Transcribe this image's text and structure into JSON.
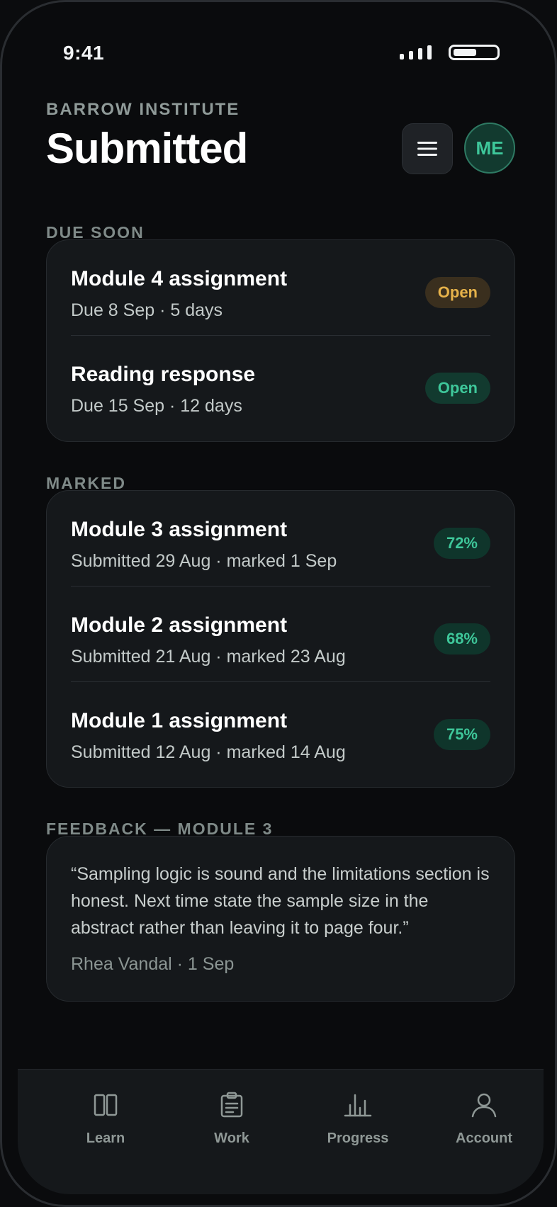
{
  "status": {
    "time": "9:41"
  },
  "header": {
    "institution": "BARROW INSTITUTE",
    "title": "Submitted",
    "avatar_initials": "ME"
  },
  "due_soon": {
    "label": "DUE SOON",
    "items": [
      {
        "title": "Module 4 assignment",
        "sub": "Due 8 Sep · 5 days",
        "badge": "Open",
        "badge_color": "#e6b24a"
      },
      {
        "title": "Reading response",
        "sub": "Due 15 Sep · 12 days",
        "badge": "Open",
        "badge_color": "#3ec79a"
      }
    ]
  },
  "marked": {
    "label": "MARKED",
    "items": [
      {
        "title": "Module 3 assignment",
        "sub": "Submitted 29 Aug · marked 1 Sep",
        "score": "72%"
      },
      {
        "title": "Module 2 assignment",
        "sub": "Submitted 21 Aug · marked 23 Aug",
        "score": "68%"
      },
      {
        "title": "Module 1 assignment",
        "sub": "Submitted 12 Aug · marked 14 Aug",
        "score": "75%"
      }
    ]
  },
  "feedback": {
    "label": "FEEDBACK — MODULE 3",
    "quote": "“Sampling logic is sound and the limitations section is honest. Next time state the sample size in the abstract rather than leaving it to page four.”",
    "meta": "Rhea Vandal · 1 Sep"
  },
  "tabbar": {
    "items": [
      {
        "label": "Learn",
        "icon": "book-icon"
      },
      {
        "label": "Work",
        "icon": "clipboard-icon"
      },
      {
        "label": "Progress",
        "icon": "bar-chart-icon"
      },
      {
        "label": "Account",
        "icon": "user-icon"
      }
    ]
  },
  "colors": {
    "accent": "#3ec79a",
    "warning": "#e6b24a",
    "background": "#0a0b0d",
    "card": "#15181b"
  }
}
